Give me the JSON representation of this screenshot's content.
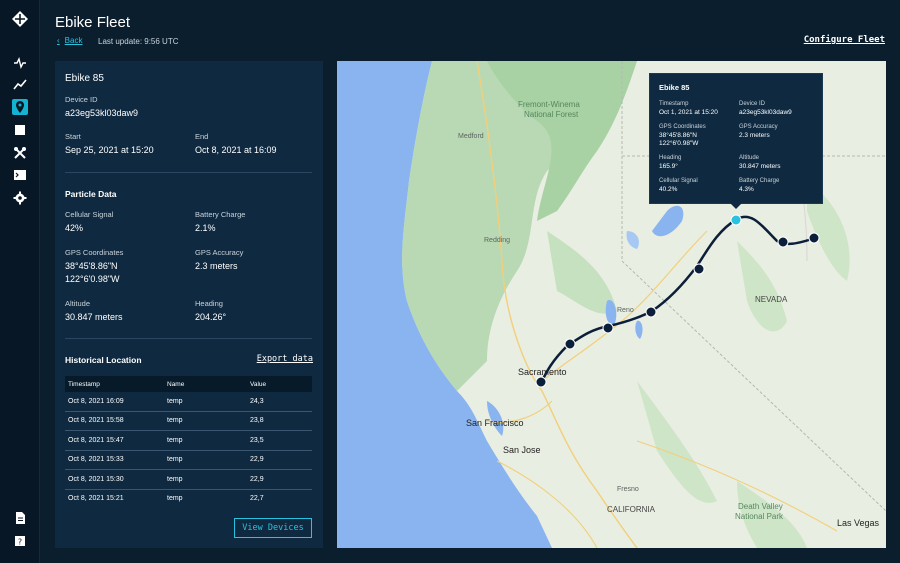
{
  "header": {
    "title": "Ebike Fleet",
    "back_label": "Back",
    "last_update": "Last update: 9:56 UTC",
    "configure_label": "Configure Fleet"
  },
  "nav": {
    "icons": [
      "logo-icon",
      "activity-icon",
      "chart-icon",
      "location-icon",
      "square-icon",
      "tools-icon",
      "terminal-icon",
      "settings-icon",
      "document-icon",
      "help-icon"
    ],
    "active": "location-icon",
    "accent_color": "#14b3d1"
  },
  "device": {
    "name": "Ebike 85",
    "id_label": "Device ID",
    "id": "a23eg53kl03daw9",
    "start_label": "Start",
    "start": "Sep 25, 2021 at 15:20",
    "end_label": "End",
    "end": "Oct 8, 2021 at 16:09"
  },
  "particle": {
    "title": "Particle Data",
    "cell_label": "Cellular Signal",
    "cell": "42%",
    "battery_label": "Battery Charge",
    "battery": "2.1%",
    "gps_label": "GPS Coordinates",
    "gps_line1": "38°45'8.86\"N",
    "gps_line2": "122°6'0.98\"W",
    "accuracy_label": "GPS Accuracy",
    "accuracy": "2.3 meters",
    "altitude_label": "Altitude",
    "altitude": "30.847 meters",
    "heading_label": "Heading",
    "heading": "204.26°"
  },
  "history": {
    "title": "Historical Location",
    "export_label": "Export data",
    "columns": [
      "Timestamp",
      "Name",
      "Value"
    ],
    "rows": [
      [
        "Oct 8, 2021 16:09",
        "temp",
        "24,3"
      ],
      [
        "Oct 8, 2021 15:58",
        "temp",
        "23,8"
      ],
      [
        "Oct 8, 2021 15:47",
        "temp",
        "23,5"
      ],
      [
        "Oct 8, 2021 15:33",
        "temp",
        "22,9"
      ],
      [
        "Oct 8, 2021 15:30",
        "temp",
        "22,9"
      ],
      [
        "Oct 8, 2021 15:21",
        "temp",
        "22,7"
      ]
    ],
    "view_devices_label": "View Devices"
  },
  "map": {
    "labels": {
      "fremont": "Fremont-Winema",
      "fremont2": "National Forest",
      "medford": "Medford",
      "redding": "Redding",
      "reno": "Reno",
      "nevada": "NEVADA",
      "sacramento": "Sacramento",
      "sanfrancisco": "San Francisco",
      "sanjose": "San Jose",
      "fresno": "Fresno",
      "california": "CALIFORNIA",
      "deathvalley": "Death Valley",
      "deathvalley2": "National Park",
      "lasvegas": "Las Vegas"
    },
    "tooltip": {
      "title": "Ebike 85",
      "timestamp_label": "Timestamp",
      "timestamp": "Oct 1, 2021 at 15:20",
      "id_label": "Device ID",
      "id": "a23eg53kl03daw9",
      "gps_label": "GPS Coordinates",
      "gps_line1": "38°45'8.86\"N",
      "gps_line2": "122°6'0.98\"W",
      "accuracy_label": "GPS Accuracy",
      "accuracy": "2.3 meters",
      "heading_label": "Heading",
      "heading": "165.9°",
      "altitude_label": "Altitude",
      "altitude": "30.847 meters",
      "cell_label": "Cellular Signal",
      "cell": "40.2%",
      "battery_label": "Battery Charge",
      "battery": "4.3%"
    },
    "route_color": "#0b1e3a",
    "selected_point_color": "#28c3e0"
  }
}
